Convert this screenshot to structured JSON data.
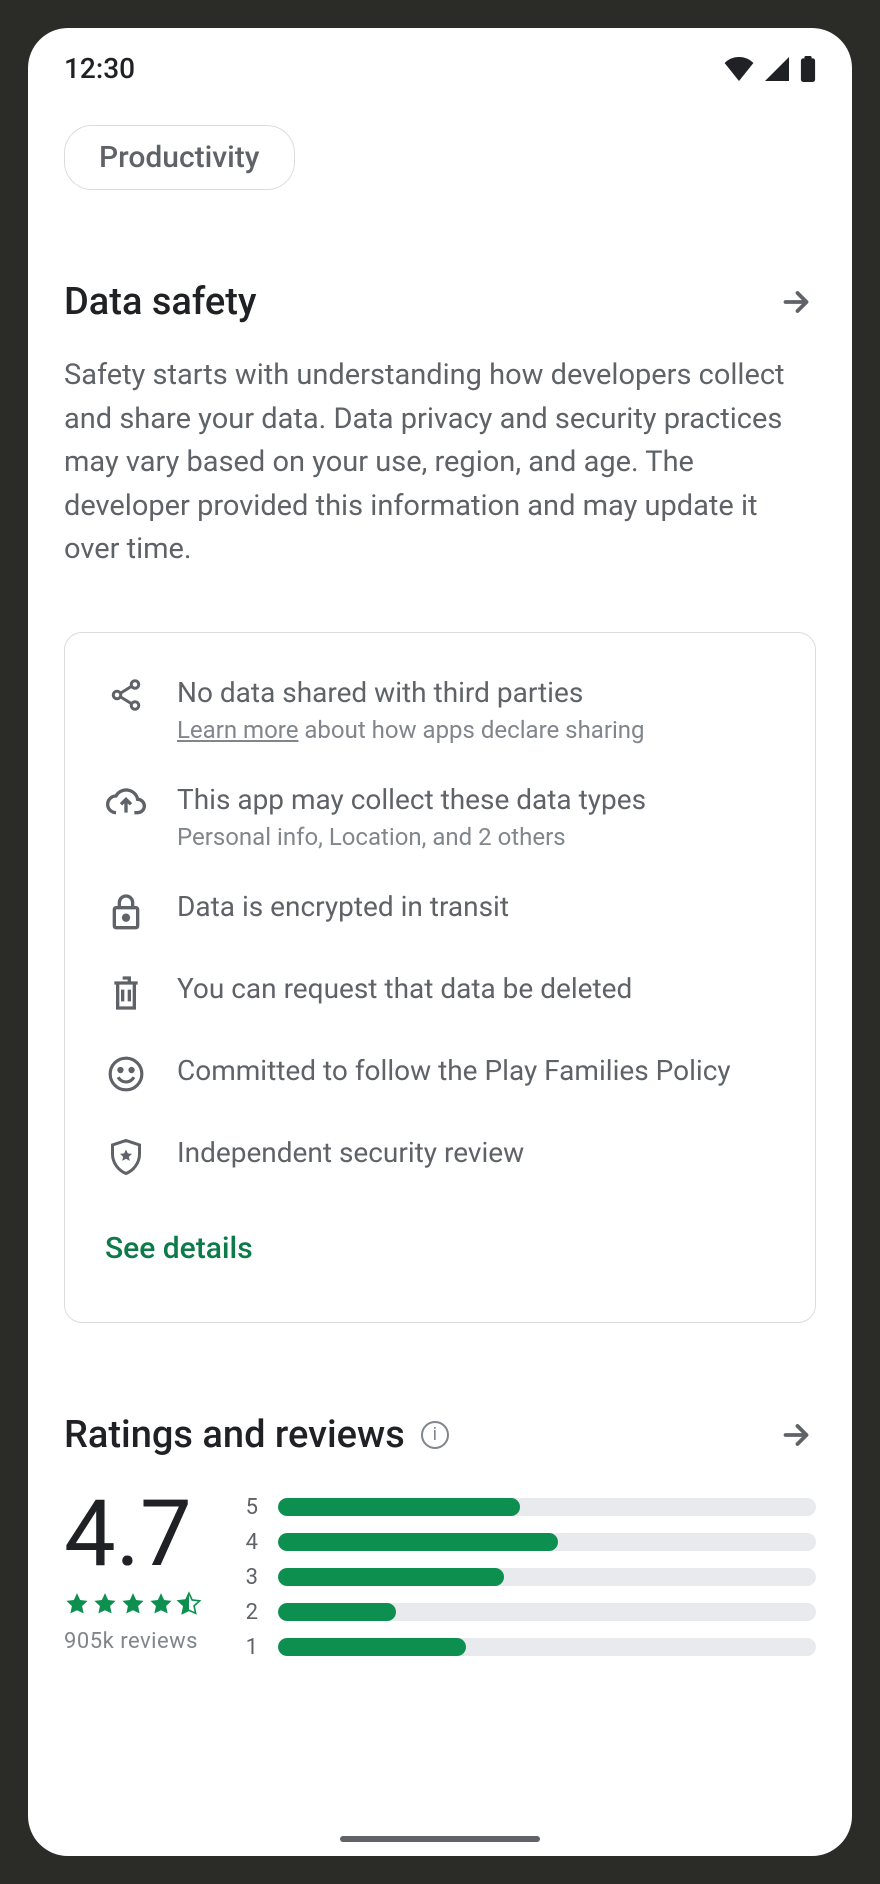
{
  "status": {
    "time": "12:30"
  },
  "chip": {
    "label": "Productivity"
  },
  "data_safety": {
    "title": "Data safety",
    "description": "Safety starts with understanding how developers collect and share your data. Data privacy and security practices may vary based on your use, region, and age. The developer provided this information and may update it over time.",
    "items": [
      {
        "icon": "share-icon",
        "title": "No data shared with third parties",
        "sub_link": "Learn more",
        "sub_rest": " about how apps declare sharing"
      },
      {
        "icon": "cloud-upload-icon",
        "title": "This app may collect these data types",
        "sub": "Personal info, Location, and 2 others"
      },
      {
        "icon": "lock-icon",
        "title": "Data is encrypted in transit"
      },
      {
        "icon": "trash-icon",
        "title": "You can request that data be deleted"
      },
      {
        "icon": "smile-icon",
        "title": "Committed to follow the Play Families Policy"
      },
      {
        "icon": "shield-star-icon",
        "title": "Independent security review"
      }
    ],
    "see_details": "See details"
  },
  "ratings": {
    "title": "Ratings and reviews",
    "score": "4.7",
    "stars_full": 4,
    "stars_half": 1,
    "review_count": "905k  reviews",
    "bars": [
      {
        "label": "5",
        "pct": 45
      },
      {
        "label": "4",
        "pct": 52
      },
      {
        "label": "3",
        "pct": 42
      },
      {
        "label": "2",
        "pct": 22
      },
      {
        "label": "1",
        "pct": 35
      }
    ]
  },
  "colors": {
    "accent_green": "#0d904f",
    "link_green": "#0d7a4a"
  }
}
